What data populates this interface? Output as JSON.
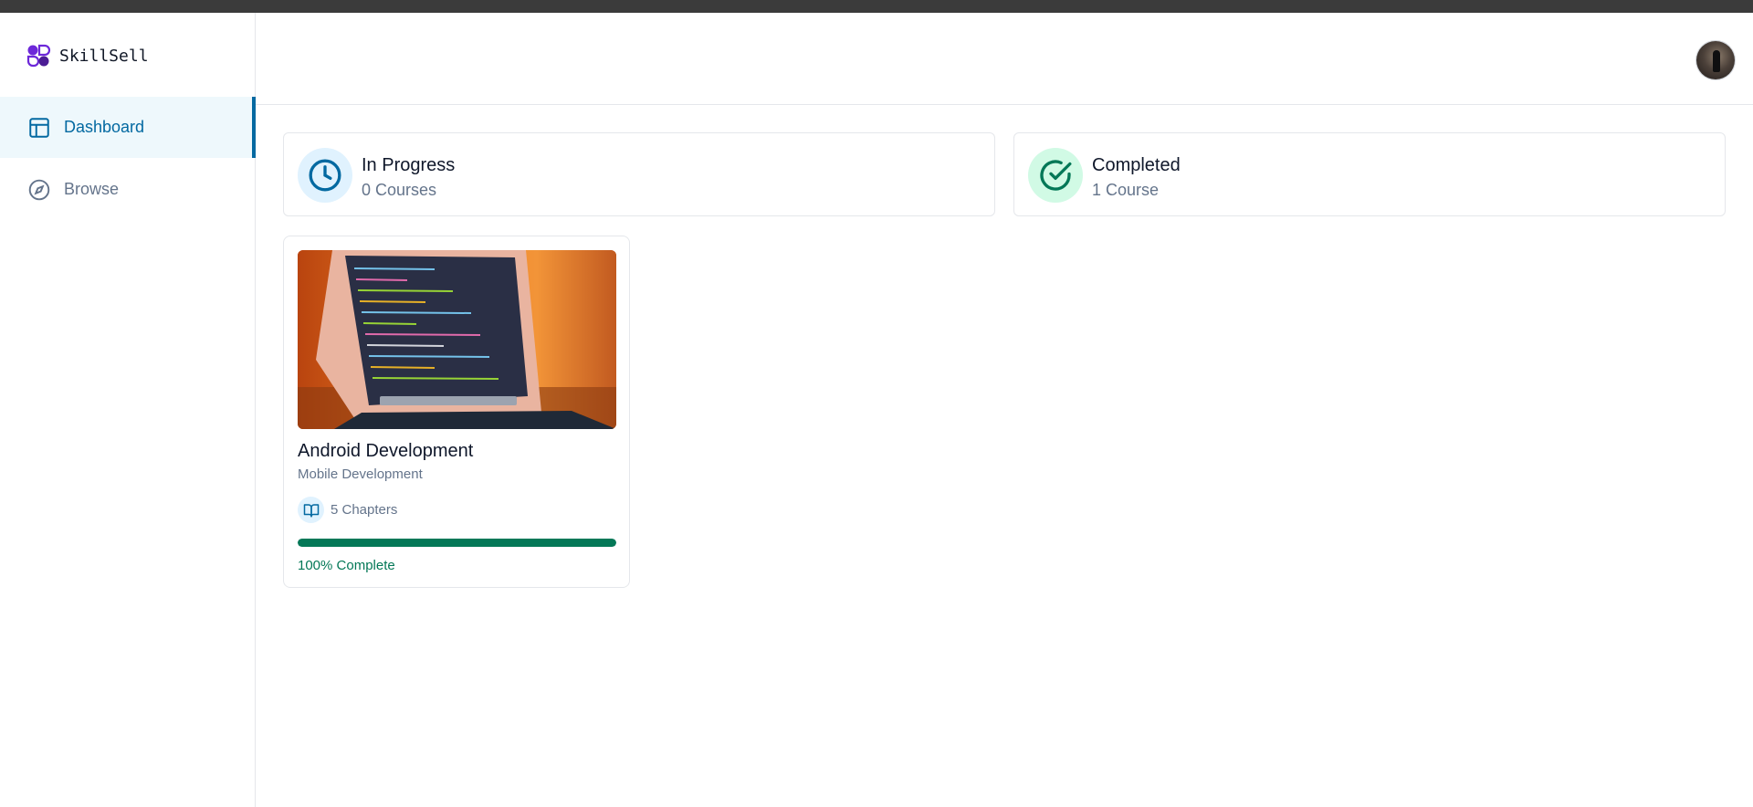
{
  "app": {
    "name": "SkillSell"
  },
  "sidebar": {
    "items": [
      {
        "label": "Dashboard",
        "icon": "layout-icon",
        "active": true
      },
      {
        "label": "Browse",
        "icon": "compass-icon",
        "active": false
      }
    ]
  },
  "header": {
    "avatar": "user-avatar"
  },
  "stats": {
    "in_progress": {
      "title": "In Progress",
      "subtitle": "0 Courses",
      "icon": "clock-icon",
      "color": "#0369a1"
    },
    "completed": {
      "title": "Completed",
      "subtitle": "1 Course",
      "icon": "check-circle-icon",
      "color": "#047857"
    }
  },
  "courses": [
    {
      "title": "Android Development",
      "category": "Mobile Development",
      "chapters": "5 Chapters",
      "progress": 100,
      "progress_label": "100% Complete"
    }
  ],
  "colors": {
    "accent": "#0369a1",
    "success": "#047857",
    "brand": "#5b21b6"
  }
}
